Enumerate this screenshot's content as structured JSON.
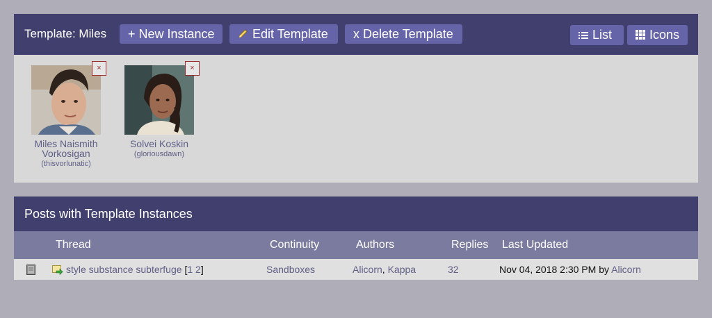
{
  "template": {
    "title": "Template: Miles",
    "new_instance_label": "+ New Instance",
    "edit_template_label": "Edit Template",
    "delete_template_label": "x Delete Template",
    "list_label": "List",
    "icons_label": "Icons",
    "characters": [
      {
        "name": "Miles Naismith Vorkosigan",
        "user": "(thisvorlunatic)",
        "remove": "×"
      },
      {
        "name": "Solvei Koskin",
        "user": "(gloriousdawn)",
        "remove": "×"
      }
    ]
  },
  "posts": {
    "header": "Posts with Template Instances",
    "columns": {
      "thread": "Thread",
      "continuity": "Continuity",
      "authors": "Authors",
      "replies": "Replies",
      "last_updated": "Last Updated"
    },
    "rows": [
      {
        "thread": "style substance subterfuge",
        "pages_open": "[",
        "page1": "1",
        "page2": "2",
        "pages_close": "]",
        "continuity": "Sandboxes",
        "author1": "Alicorn",
        "author_sep": ",",
        "author2": "Kappa",
        "replies": "32",
        "last_updated": "Nov 04, 2018 2:30 PM",
        "by": "by",
        "last_author": "Alicorn"
      }
    ]
  },
  "colors": {
    "header_bg": "#413f6e",
    "button_bg": "#6664a8",
    "link": "#5f5e86",
    "page_bg": "#aeadb8",
    "panel_bg": "#d8d8d8"
  },
  "icons": [
    "pencil-icon",
    "list-icon",
    "grid-icon",
    "book-icon",
    "new-post-icon"
  ]
}
